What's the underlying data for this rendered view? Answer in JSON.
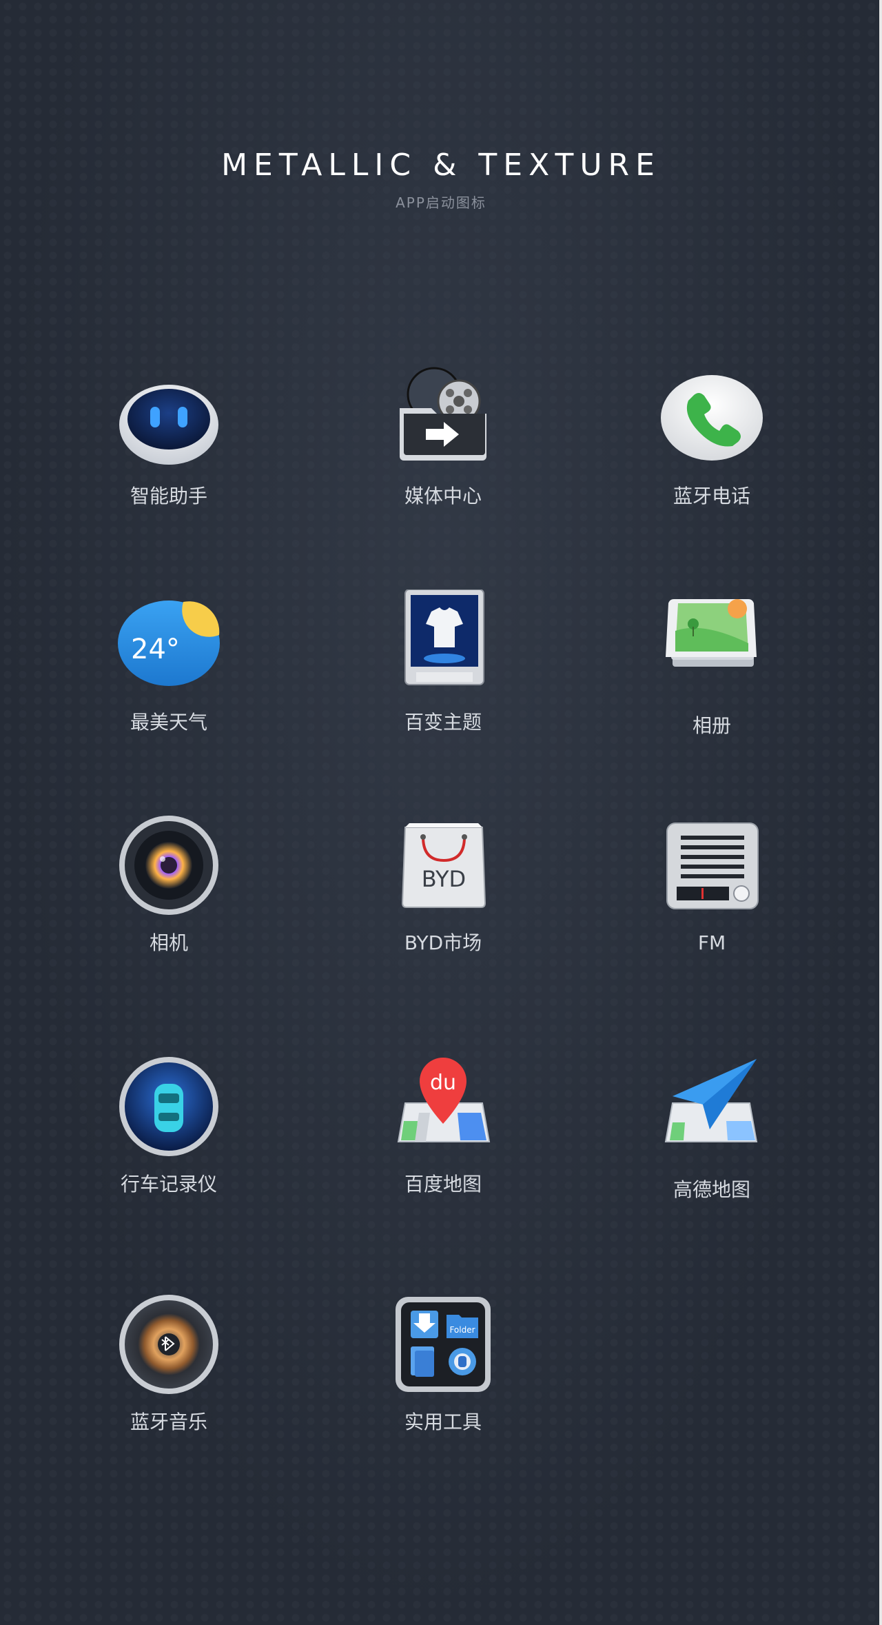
{
  "header": {
    "title": "METALLIC & TEXTURE",
    "subtitle": "APP启动图标"
  },
  "apps": [
    {
      "label": "智能助手",
      "icon": "robot-icon"
    },
    {
      "label": "媒体中心",
      "icon": "media-folder-icon"
    },
    {
      "label": "蓝牙电话",
      "icon": "phone-icon"
    },
    {
      "label": "最美天气",
      "icon": "weather-icon",
      "badge": "24°"
    },
    {
      "label": "百变主题",
      "icon": "theme-shirt-icon"
    },
    {
      "label": "相册",
      "icon": "photo-album-icon"
    },
    {
      "label": "相机",
      "icon": "camera-lens-icon"
    },
    {
      "label": "BYD市场",
      "icon": "shopping-bag-icon",
      "badge": "BYD"
    },
    {
      "label": "FM",
      "icon": "radio-icon"
    },
    {
      "label": "行车记录仪",
      "icon": "dashcam-car-icon"
    },
    {
      "label": "百度地图",
      "icon": "baidu-map-pin-icon",
      "badge": "du"
    },
    {
      "label": "高德地图",
      "icon": "amap-plane-icon"
    },
    {
      "label": "蓝牙音乐",
      "icon": "bluetooth-vinyl-icon"
    },
    {
      "label": "实用工具",
      "icon": "tools-folder-icon",
      "badge": "Folder"
    }
  ],
  "colors": {
    "background": "#252b36",
    "label": "#d7dbe1",
    "subtitle": "#8b919c",
    "accent_blue": "#2f8fe8"
  }
}
